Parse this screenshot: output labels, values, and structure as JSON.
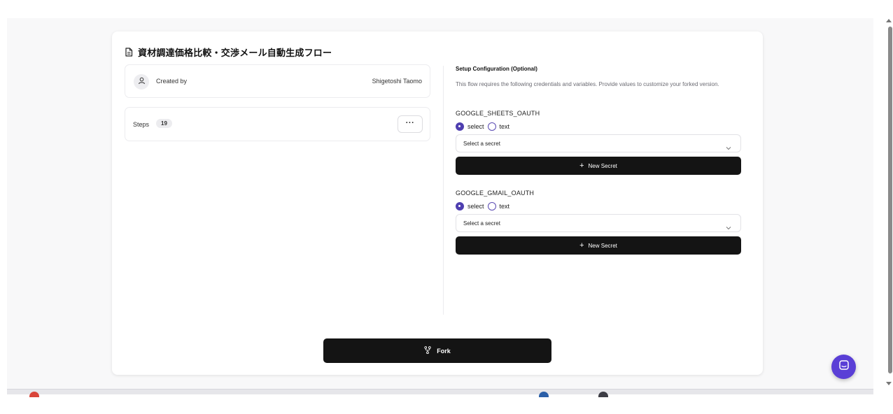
{
  "flow": {
    "title": "資材調達価格比較・交渉メール自動生成フロー",
    "title_icon": "document-icon"
  },
  "creator": {
    "label": "Created by",
    "name": "Shigetoshi Taomo",
    "icon": "user-icon"
  },
  "steps": {
    "label": "Steps",
    "count": "19",
    "more_label": "···"
  },
  "setup": {
    "title": "Setup Configuration (Optional)",
    "description": "This flow requires the following credentials and variables. Provide values to customize your forked version.",
    "variables": [
      {
        "name": "GOOGLE_SHEETS_OAUTH",
        "option_select": "select",
        "option_text": "text",
        "selected_option": "select",
        "select_placeholder": "Select a secret",
        "new_secret_label": "New Secret"
      },
      {
        "name": "GOOGLE_GMAIL_OAUTH",
        "option_select": "select",
        "option_text": "text",
        "selected_option": "select",
        "select_placeholder": "Select a secret",
        "new_secret_label": "New Secret"
      }
    ]
  },
  "fork": {
    "label": "Fork",
    "icon": "fork-icon"
  },
  "colors": {
    "primary_button": "#141414",
    "radio_accent": "#4f3fb0",
    "chat_button": "#5a3fd6"
  }
}
